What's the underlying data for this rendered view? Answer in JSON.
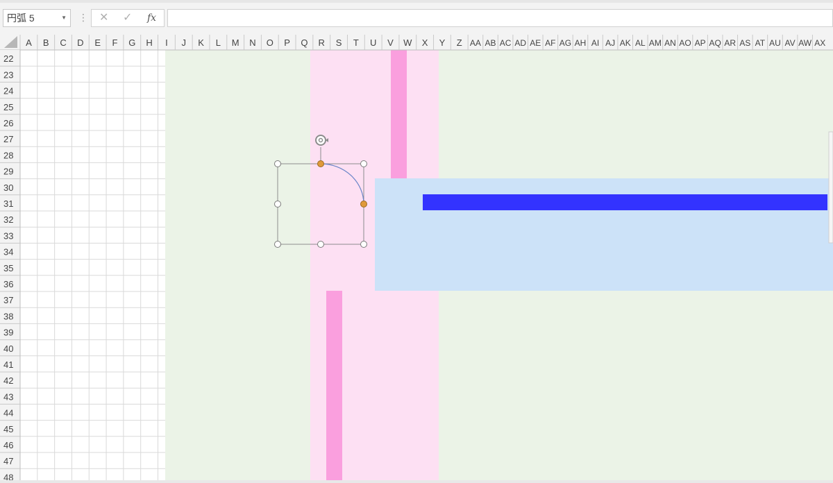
{
  "namebox": {
    "value": "円弧 5"
  },
  "formula_bar": {
    "cancel_icon": "x-icon",
    "enter_icon": "check-icon",
    "function_label": "fx",
    "value": ""
  },
  "columns": [
    "A",
    "B",
    "C",
    "D",
    "E",
    "F",
    "G",
    "H",
    "I",
    "J",
    "K",
    "L",
    "M",
    "N",
    "O",
    "P",
    "Q",
    "R",
    "S",
    "T",
    "U",
    "V",
    "W",
    "X",
    "Y",
    "Z",
    "AA",
    "AB",
    "AC",
    "AD",
    "AE",
    "AF",
    "AG",
    "AH",
    "AI",
    "AJ",
    "AK",
    "AL",
    "AM",
    "AN",
    "AO",
    "AP",
    "AQ",
    "AR",
    "AS",
    "AT",
    "AU",
    "AV",
    "AW",
    "AX"
  ],
  "rows": [
    "22",
    "23",
    "24",
    "25",
    "26",
    "27",
    "28",
    "29",
    "30",
    "31",
    "32",
    "33",
    "34",
    "35",
    "36",
    "37",
    "38",
    "39",
    "40",
    "41",
    "42",
    "43",
    "44",
    "45",
    "46",
    "47",
    "48"
  ],
  "colors": {
    "green_fill": "#ebf3e7",
    "pink_fill": "#fde0f3",
    "pink_bar": "#fa9fde",
    "blue_fill": "#cce2f8",
    "blue_bar": "#3333ff",
    "arc_stroke": "#6a85c8",
    "handle_orange": "#e09a3a"
  }
}
